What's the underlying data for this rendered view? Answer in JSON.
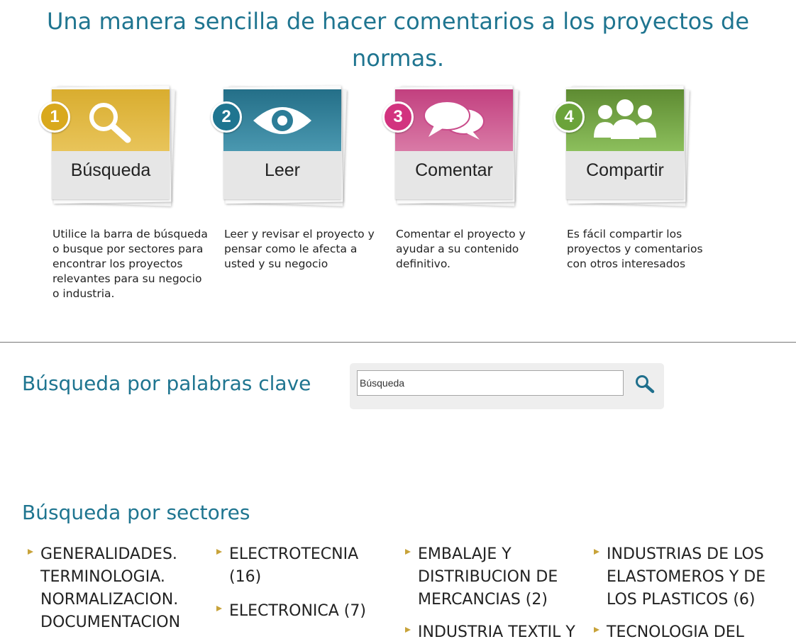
{
  "headline": "Una manera sencilla de hacer comentarios a los proyectos de normas.",
  "steps": [
    {
      "number": "1",
      "label": "Búsqueda",
      "icon": "magnifier-icon",
      "color": "#d9ad2f",
      "description": "Utilice la barra de búsqueda o busque por sectores para encontrar los proyectos relevantes para su negocio o industria."
    },
    {
      "number": "2",
      "label": "Leer",
      "icon": "eye-icon",
      "color": "#2c7d97",
      "description": "Leer y revisar el proyecto y pensar como le afecta a usted y su negocio"
    },
    {
      "number": "3",
      "label": "Comentar",
      "icon": "speech-bubbles-icon",
      "color": "#c94b8a",
      "description": "Comentar el proyecto y ayudar a su contenido definitivo."
    },
    {
      "number": "4",
      "label": "Compartir",
      "icon": "people-group-icon",
      "color": "#6b9a3c",
      "description": "Es fácil compartir los proyectos y comentarios con otros interesados"
    }
  ],
  "keyword_search": {
    "title": "Búsqueda por palabras clave",
    "input_value": "Búsqueda",
    "button_icon": "search-icon"
  },
  "sectors": {
    "title": "Búsqueda por sectores",
    "items": [
      "GENERALIDADES. TERMINOLOGIA. NORMALIZACION. DOCUMENTACION",
      "ELECTROTECNIA (16)",
      "ELECTRONICA (7)",
      "EMBALAJE Y DISTRIBUCION DE MERCANCIAS (2)",
      "INDUSTRIA TEXTIL Y",
      "INDUSTRIAS DE LOS ELASTOMEROS Y DE LOS PLASTICOS (6)",
      "TECNOLOGIA DEL"
    ]
  },
  "colors": {
    "accent": "#1f7590",
    "bullet": "#c8a33a"
  }
}
